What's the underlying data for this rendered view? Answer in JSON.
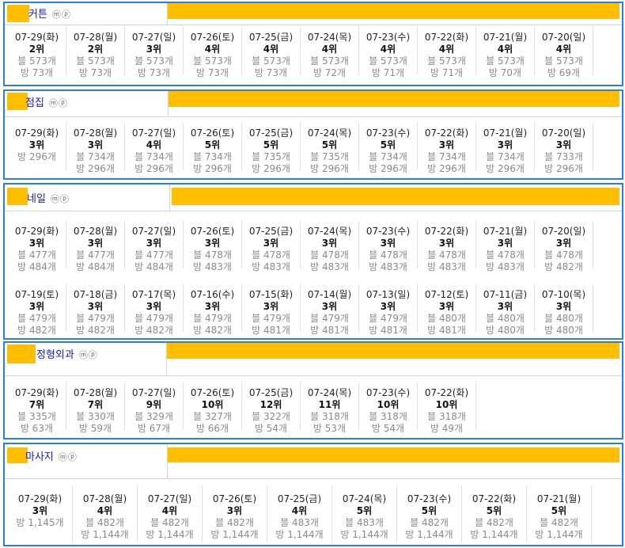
{
  "mp_label": "ⓜⓟ",
  "sections": [
    {
      "keyword": "커튼",
      "rows": [
        [
          {
            "date": "07-29(화)",
            "rank": "2위",
            "blog": "블 573개",
            "bang": "방 73개"
          },
          {
            "date": "07-28(월)",
            "rank": "2위",
            "blog": "블 573개",
            "bang": "방 73개"
          },
          {
            "date": "07-27(일)",
            "rank": "3위",
            "blog": "블 573개",
            "bang": "방 73개"
          },
          {
            "date": "07-26(토)",
            "rank": "4위",
            "blog": "블 573개",
            "bang": "방 73개"
          },
          {
            "date": "07-25(금)",
            "rank": "4위",
            "blog": "블 573개",
            "bang": "방 73개"
          },
          {
            "date": "07-24(목)",
            "rank": "4위",
            "blog": "블 573개",
            "bang": "방 72개"
          },
          {
            "date": "07-23(수)",
            "rank": "4위",
            "blog": "블 573개",
            "bang": "방 71개"
          },
          {
            "date": "07-22(화)",
            "rank": "4위",
            "blog": "블 573개",
            "bang": "방 71개"
          },
          {
            "date": "07-21(월)",
            "rank": "4위",
            "blog": "블 573개",
            "bang": "방 70개"
          },
          {
            "date": "07-20(일)",
            "rank": "4위",
            "blog": "블 573개",
            "bang": "방 69개"
          }
        ]
      ]
    },
    {
      "keyword": "점집",
      "rows": [
        [
          {
            "date": "07-29(화)",
            "rank": "3위",
            "blog": "방 296개",
            "bang": ""
          },
          {
            "date": "07-28(월)",
            "rank": "3위",
            "blog": "블 734개",
            "bang": "방 296개"
          },
          {
            "date": "07-27(일)",
            "rank": "4위",
            "blog": "블 734개",
            "bang": "방 296개"
          },
          {
            "date": "07-26(토)",
            "rank": "5위",
            "blog": "블 734개",
            "bang": "방 296개"
          },
          {
            "date": "07-25(금)",
            "rank": "5위",
            "blog": "블 735개",
            "bang": "방 296개"
          },
          {
            "date": "07-24(목)",
            "rank": "5위",
            "blog": "블 735개",
            "bang": "방 296개"
          },
          {
            "date": "07-23(수)",
            "rank": "5위",
            "blog": "블 734개",
            "bang": "방 296개"
          },
          {
            "date": "07-22(화)",
            "rank": "3위",
            "blog": "블 734개",
            "bang": "방 296개"
          },
          {
            "date": "07-21(월)",
            "rank": "3위",
            "blog": "블 734개",
            "bang": "방 296개"
          },
          {
            "date": "07-20(일)",
            "rank": "3위",
            "blog": "블 733개",
            "bang": "방 296개"
          }
        ]
      ]
    },
    {
      "keyword": "네일",
      "rows": [
        [
          {
            "date": "07-29(화)",
            "rank": "3위",
            "blog": "블 477개",
            "bang": "방 484개"
          },
          {
            "date": "07-28(월)",
            "rank": "3위",
            "blog": "블 477개",
            "bang": "방 484개"
          },
          {
            "date": "07-27(일)",
            "rank": "3위",
            "blog": "블 477개",
            "bang": "방 484개"
          },
          {
            "date": "07-26(토)",
            "rank": "3위",
            "blog": "블 478개",
            "bang": "방 483개"
          },
          {
            "date": "07-25(금)",
            "rank": "3위",
            "blog": "블 478개",
            "bang": "방 483개"
          },
          {
            "date": "07-24(목)",
            "rank": "3위",
            "blog": "블 478개",
            "bang": "방 483개"
          },
          {
            "date": "07-23(수)",
            "rank": "3위",
            "blog": "블 478개",
            "bang": "방 483개"
          },
          {
            "date": "07-22(화)",
            "rank": "3위",
            "blog": "블 478개",
            "bang": "방 483개"
          },
          {
            "date": "07-21(월)",
            "rank": "3위",
            "blog": "블 478개",
            "bang": "방 483개"
          },
          {
            "date": "07-20(일)",
            "rank": "3위",
            "blog": "블 478개",
            "bang": "방 482개"
          }
        ],
        [
          {
            "date": "07-19(토)",
            "rank": "3위",
            "blog": "블 479개",
            "bang": "방 482개"
          },
          {
            "date": "07-18(금)",
            "rank": "3위",
            "blog": "블 479개",
            "bang": "방 482개"
          },
          {
            "date": "07-17(목)",
            "rank": "3위",
            "blog": "블 479개",
            "bang": "방 482개"
          },
          {
            "date": "07-16(수)",
            "rank": "3위",
            "blog": "블 479개",
            "bang": "방 482개"
          },
          {
            "date": "07-15(화)",
            "rank": "3위",
            "blog": "블 479개",
            "bang": "방 481개"
          },
          {
            "date": "07-14(월)",
            "rank": "3위",
            "blog": "블 479개",
            "bang": "방 481개"
          },
          {
            "date": "07-13(일)",
            "rank": "3위",
            "blog": "블 479개",
            "bang": "방 481개"
          },
          {
            "date": "07-12(토)",
            "rank": "3위",
            "blog": "블 480개",
            "bang": "방 481개"
          },
          {
            "date": "07-11(금)",
            "rank": "3위",
            "blog": "블 480개",
            "bang": "방 480개"
          },
          {
            "date": "07-10(목)",
            "rank": "3위",
            "blog": "블 480개",
            "bang": "방 480개"
          }
        ]
      ]
    },
    {
      "keyword": "정형외과",
      "rows": [
        [
          {
            "date": "07-29(화)",
            "rank": "7위",
            "blog": "블 335개",
            "bang": "방 63개"
          },
          {
            "date": "07-28(월)",
            "rank": "7위",
            "blog": "블 330개",
            "bang": "방 59개"
          },
          {
            "date": "07-27(일)",
            "rank": "9위",
            "blog": "블 329개",
            "bang": "방 67개"
          },
          {
            "date": "07-26(토)",
            "rank": "10위",
            "blog": "블 327개",
            "bang": "방 66개"
          },
          {
            "date": "07-25(금)",
            "rank": "12위",
            "blog": "블 322개",
            "bang": "방 54개"
          },
          {
            "date": "07-24(목)",
            "rank": "11위",
            "blog": "블 318개",
            "bang": "방 53개"
          },
          {
            "date": "07-23(수)",
            "rank": "10위",
            "blog": "블 318개",
            "bang": "방 54개"
          },
          {
            "date": "07-22(화)",
            "rank": "10위",
            "blog": "블 318개",
            "bang": "방 49개"
          }
        ]
      ]
    },
    {
      "keyword": "마사지",
      "rows": [
        [
          {
            "date": "07-29(화)",
            "rank": "3위",
            "blog": "방 1,145개",
            "bang": ""
          },
          {
            "date": "07-28(월)",
            "rank": "4위",
            "blog": "블 482개",
            "bang": "방 1,144개"
          },
          {
            "date": "07-27(일)",
            "rank": "4위",
            "blog": "블 482개",
            "bang": "방 1,144개"
          },
          {
            "date": "07-26(토)",
            "rank": "3위",
            "blog": "블 482개",
            "bang": "방 1,144개"
          },
          {
            "date": "07-25(금)",
            "rank": "4위",
            "blog": "블 483개",
            "bang": "방 1,144개"
          },
          {
            "date": "07-24(목)",
            "rank": "5위",
            "blog": "블 483개",
            "bang": "방 1,144개"
          },
          {
            "date": "07-23(수)",
            "rank": "5위",
            "blog": "블 482개",
            "bang": "방 1,144개"
          },
          {
            "date": "07-22(화)",
            "rank": "5위",
            "blog": "블 482개",
            "bang": "방 1,144개"
          },
          {
            "date": "07-21(월)",
            "rank": "5위",
            "blog": "블 482개",
            "bang": "방 1,144개"
          }
        ]
      ]
    }
  ]
}
